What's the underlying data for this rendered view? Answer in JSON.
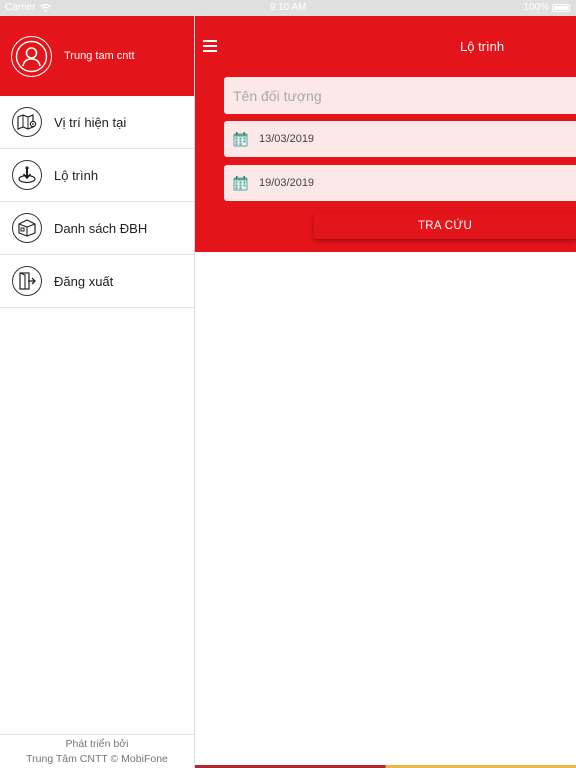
{
  "status_bar": {
    "carrier": "Carrier",
    "time": "9:10 AM",
    "battery": "100%"
  },
  "sidebar": {
    "user_name": "Trung tam cntt",
    "items": [
      {
        "label": "Vị trí hiện tại",
        "icon": "map-pin-icon"
      },
      {
        "label": "Lộ trình",
        "icon": "route-icon"
      },
      {
        "label": "Danh sách ĐBH",
        "icon": "store-list-icon"
      },
      {
        "label": "Đăng xuất",
        "icon": "logout-icon"
      }
    ],
    "footer_line1": "Phát triển bởi",
    "footer_line2": "Trung Tâm CNTT © MobiFone"
  },
  "main": {
    "title": "Lộ trình",
    "object_name_placeholder": "Tên đối tượng",
    "object_name_value": "",
    "date_from": "13/03/2019",
    "date_to": "19/03/2019",
    "search_label": "TRA CỨU"
  },
  "colors": {
    "primary_red": "#e4141b",
    "input_bg": "#fde8e8",
    "calendar_green": "#5aa69a"
  }
}
